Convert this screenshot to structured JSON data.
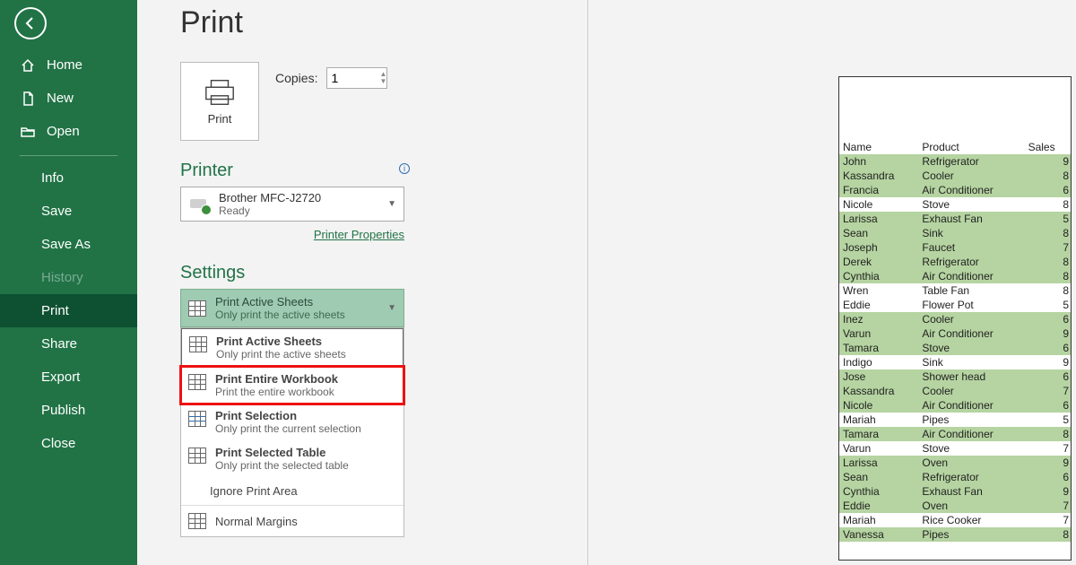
{
  "sidebar": {
    "items": [
      {
        "label": "Home"
      },
      {
        "label": "New"
      },
      {
        "label": "Open"
      }
    ],
    "file_items": [
      {
        "label": "Info"
      },
      {
        "label": "Save"
      },
      {
        "label": "Save As"
      },
      {
        "label": "History",
        "disabled": true
      },
      {
        "label": "Print",
        "active": true
      },
      {
        "label": "Share"
      },
      {
        "label": "Export"
      },
      {
        "label": "Publish"
      },
      {
        "label": "Close"
      }
    ]
  },
  "page": {
    "title": "Print",
    "print_button": "Print",
    "copies_label": "Copies:",
    "copies_value": "1"
  },
  "printer": {
    "section_title": "Printer",
    "name": "Brother MFC-J2720",
    "status": "Ready",
    "properties_link": "Printer Properties"
  },
  "settings": {
    "section_title": "Settings",
    "selected": {
      "title": "Print Active Sheets",
      "subtitle": "Only print the active sheets"
    },
    "options": [
      {
        "title": "Print Active Sheets",
        "subtitle": "Only print the active sheets"
      },
      {
        "title": "Print Entire Workbook",
        "subtitle": "Print the entire workbook"
      },
      {
        "title": "Print Selection",
        "subtitle": "Only print the current selection"
      },
      {
        "title": "Print Selected Table",
        "subtitle": "Only print the selected table"
      }
    ],
    "ignore": "Ignore Print Area",
    "margins": "Normal Margins"
  },
  "preview": {
    "headers": [
      "Name",
      "Product",
      "Sales"
    ],
    "rows": [
      {
        "n": "John",
        "p": "Refrigerator",
        "s": "9",
        "g": 1
      },
      {
        "n": "Kassandra",
        "p": "Cooler",
        "s": "8",
        "g": 1
      },
      {
        "n": "Francia",
        "p": "Air Conditioner",
        "s": "6",
        "g": 1
      },
      {
        "n": "Nicole",
        "p": "Stove",
        "s": "8",
        "g": 0
      },
      {
        "n": "Larissa",
        "p": "Exhaust Fan",
        "s": "5",
        "g": 1
      },
      {
        "n": "Sean",
        "p": "Sink",
        "s": "8",
        "g": 1
      },
      {
        "n": "Joseph",
        "p": "Faucet",
        "s": "7",
        "g": 1
      },
      {
        "n": "Derek",
        "p": "Refrigerator",
        "s": "8",
        "g": 1
      },
      {
        "n": "Cynthia",
        "p": "Air Conditioner",
        "s": "8",
        "g": 1
      },
      {
        "n": "Wren",
        "p": "Table Fan",
        "s": "8",
        "g": 0
      },
      {
        "n": "Eddie",
        "p": "Flower Pot",
        "s": "5",
        "g": 0
      },
      {
        "n": "Inez",
        "p": "Cooler",
        "s": "6",
        "g": 1
      },
      {
        "n": "Varun",
        "p": "Air Conditioner",
        "s": "9",
        "g": 1
      },
      {
        "n": "Tamara",
        "p": "Stove",
        "s": "6",
        "g": 1
      },
      {
        "n": "Indigo",
        "p": "Sink",
        "s": "9",
        "g": 0
      },
      {
        "n": "Jose",
        "p": "Shower head",
        "s": "6",
        "g": 1
      },
      {
        "n": "Kassandra",
        "p": "Cooler",
        "s": "7",
        "g": 1
      },
      {
        "n": "Nicole",
        "p": "Air Conditioner",
        "s": "6",
        "g": 1
      },
      {
        "n": "Mariah",
        "p": "Pipes",
        "s": "5",
        "g": 0
      },
      {
        "n": "Tamara",
        "p": "Air Conditioner",
        "s": "8",
        "g": 1
      },
      {
        "n": "Varun",
        "p": "Stove",
        "s": "7",
        "g": 0
      },
      {
        "n": "Larissa",
        "p": "Oven",
        "s": "9",
        "g": 1
      },
      {
        "n": "Sean",
        "p": "Refrigerator",
        "s": "6",
        "g": 1
      },
      {
        "n": "Cynthia",
        "p": "Exhaust Fan",
        "s": "9",
        "g": 1
      },
      {
        "n": "Eddie",
        "p": "Oven",
        "s": "7",
        "g": 1
      },
      {
        "n": "Mariah",
        "p": "Rice Cooker",
        "s": "7",
        "g": 0
      },
      {
        "n": "Vanessa",
        "p": "Pipes",
        "s": "8",
        "g": 1
      }
    ]
  }
}
